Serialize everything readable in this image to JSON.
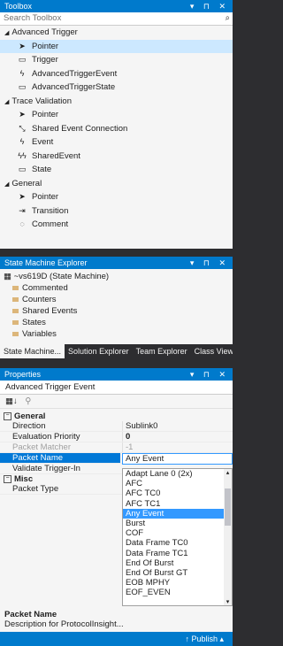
{
  "toolbox": {
    "title": "Toolbox",
    "controls": "▾ ⊓ ✕",
    "search_placeholder": "Search Toolbox",
    "groups": [
      {
        "label": "Advanced Trigger",
        "items": [
          {
            "label": "Pointer",
            "icon": "pointer-icon",
            "glyph": "➤",
            "selected": true
          },
          {
            "label": "Trigger",
            "icon": "state-icon",
            "glyph": "▭"
          },
          {
            "label": "AdvancedTriggerEvent",
            "icon": "event-icon",
            "glyph": "ϟ"
          },
          {
            "label": "AdvancedTriggerState",
            "icon": "state-icon",
            "glyph": "▭"
          }
        ]
      },
      {
        "label": "Trace Validation",
        "items": [
          {
            "label": "Pointer",
            "icon": "pointer-icon",
            "glyph": "➤"
          },
          {
            "label": "Shared Event Connection",
            "icon": "connection-icon",
            "glyph": "⤡"
          },
          {
            "label": "Event",
            "icon": "event-icon",
            "glyph": "ϟ"
          },
          {
            "label": "SharedEvent",
            "icon": "shared-event-icon",
            "glyph": "ϟϟ"
          },
          {
            "label": "State",
            "icon": "state-icon",
            "glyph": "▭"
          }
        ]
      },
      {
        "label": "General",
        "items": [
          {
            "label": "Pointer",
            "icon": "pointer-icon",
            "glyph": "➤"
          },
          {
            "label": "Transition",
            "icon": "transition-icon",
            "glyph": "⇥"
          },
          {
            "label": "Comment",
            "icon": "comment-icon",
            "glyph": "◌"
          }
        ]
      }
    ]
  },
  "explorer": {
    "title": "State Machine Explorer",
    "controls": "▾ ⊓ ✕",
    "root": "~vs619D (State Machine)",
    "nodes": [
      "Commented",
      "Counters",
      "Shared Events",
      "States",
      "Variables"
    ]
  },
  "tabs": [
    "State Machine...",
    "Solution Explorer",
    "Team Explorer",
    "Class View"
  ],
  "properties": {
    "title": "Properties",
    "controls": "▾ ⊓ ✕",
    "object": "Advanced Trigger Event",
    "categories": [
      {
        "label": "General",
        "props": [
          {
            "name": "Direction",
            "value": "Sublink0"
          },
          {
            "name": "Evaluation Priority",
            "value": "0",
            "bold": true
          },
          {
            "name": "Packet Matcher",
            "value": "-1",
            "dim": true
          },
          {
            "name": "Packet Name",
            "value": "Any Event",
            "selected": true
          },
          {
            "name": "Validate Trigger-In",
            "value": ""
          }
        ]
      },
      {
        "label": "Misc",
        "props": [
          {
            "name": "Packet Type",
            "value": ""
          }
        ]
      }
    ],
    "dropdown_options": [
      "Adapt Lane 0 (2x)",
      "AFC",
      "AFC TC0",
      "AFC TC1",
      "Any Event",
      "Burst",
      "COF",
      "Data Frame TC0",
      "Data Frame TC1",
      "End Of Burst",
      "End Of Burst GT",
      "EOB MPHY",
      "EOF_EVEN"
    ],
    "dropdown_selected": "Any Event",
    "description_title": "Packet Name",
    "description_text": "Description for ProtocolInsight..."
  },
  "status": {
    "publish": "↑ Publish ▴"
  }
}
